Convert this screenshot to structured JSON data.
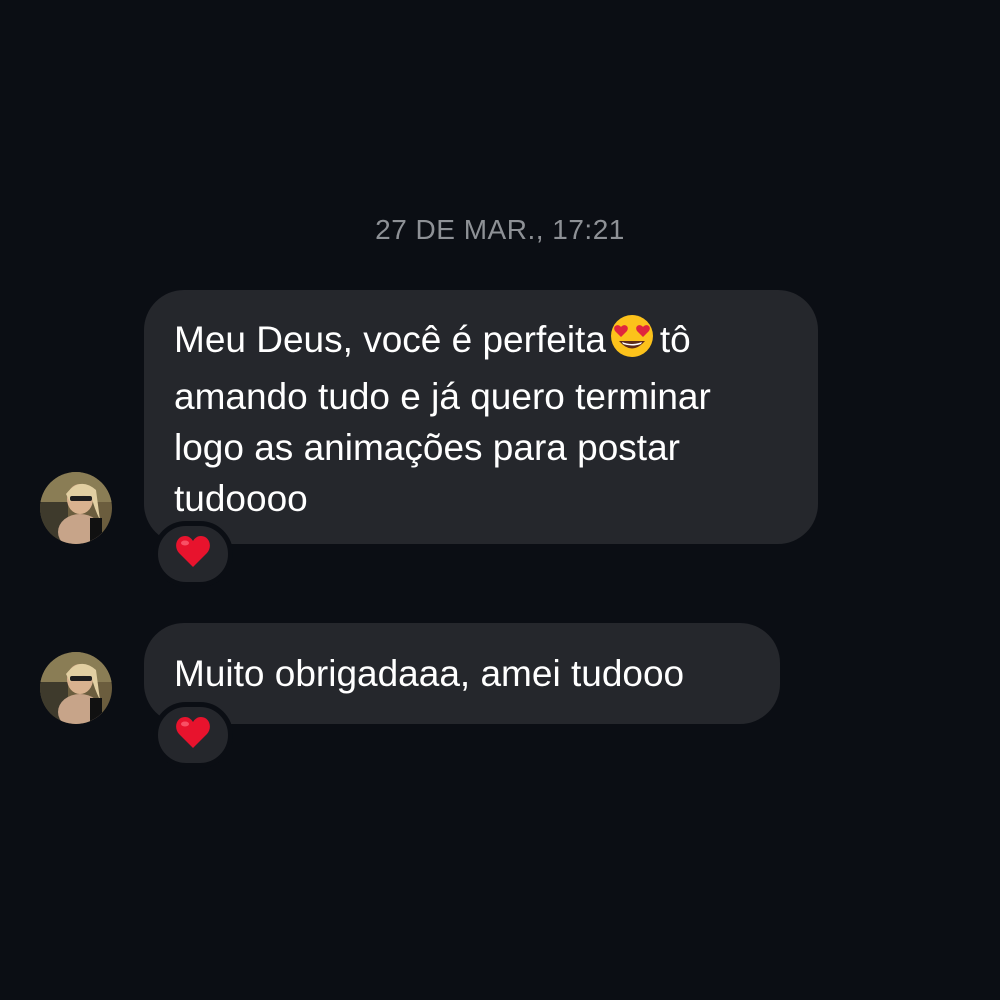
{
  "conversation": {
    "timestamp": "27 DE MAR., 17:21",
    "messages": [
      {
        "lines": [
          "Meu Deus, você é perfeita",
          "tô",
          "amando tudo e já quero terminar",
          "logo as animações para postar",
          "tudoooo"
        ],
        "inline_emoji": "heart-eyes-emoji",
        "reaction": "❤️",
        "sender_avatar": "avatar"
      },
      {
        "lines": [
          "Muito obrigadaaa, amei tudooo"
        ],
        "reaction": "❤️",
        "sender_avatar": "avatar"
      }
    ]
  },
  "colors": {
    "background": "#0b0e14",
    "bubble": "#25272c",
    "timestamp": "#8e9196",
    "text": "#ffffff",
    "heart": "#e8132d"
  }
}
